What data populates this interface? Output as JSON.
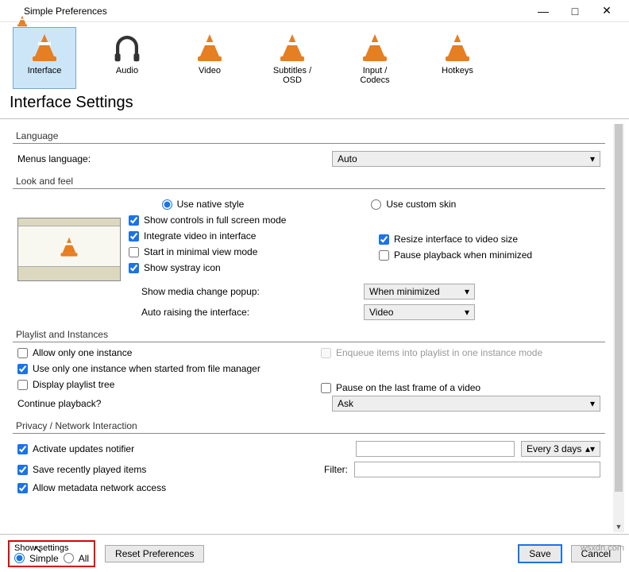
{
  "titlebar": {
    "title": "Simple Preferences"
  },
  "tabs": {
    "interface": "Interface",
    "audio": "Audio",
    "video": "Video",
    "subtitles": "Subtitles / OSD",
    "input": "Input / Codecs",
    "hotkeys": "Hotkeys"
  },
  "page_title": "Interface Settings",
  "language": {
    "group": "Language",
    "menus_label": "Menus language:",
    "menus_value": "Auto"
  },
  "look": {
    "group": "Look and feel",
    "native": "Use native style",
    "custom": "Use custom skin",
    "show_controls": "Show controls in full screen mode",
    "integrate": "Integrate video in interface",
    "minimal": "Start in minimal view mode",
    "systray": "Show systray icon",
    "resize": "Resize interface to video size",
    "pause_min": "Pause playback when minimized",
    "media_popup_label": "Show media change popup:",
    "media_popup_value": "When minimized",
    "auto_raise_label": "Auto raising the interface:",
    "auto_raise_value": "Video"
  },
  "playlist": {
    "group": "Playlist and Instances",
    "one_instance": "Allow only one instance",
    "one_fm": "Use only one instance when started from file manager",
    "tree": "Display playlist tree",
    "enqueue": "Enqueue items into playlist in one instance mode",
    "pause_last": "Pause on the last frame of a video",
    "continue_label": "Continue playback?",
    "continue_value": "Ask"
  },
  "privacy": {
    "group": "Privacy / Network Interaction",
    "updates": "Activate updates notifier",
    "recent": "Save recently played items",
    "metadata": "Allow metadata network access",
    "every_value": "Every 3 days",
    "filter_label": "Filter:"
  },
  "footer": {
    "show_settings": "Show settings",
    "simple": "Simple",
    "all": "All",
    "reset": "Reset Preferences",
    "save": "Save",
    "cancel": "Cancel"
  },
  "watermark": "wsxdn.com"
}
